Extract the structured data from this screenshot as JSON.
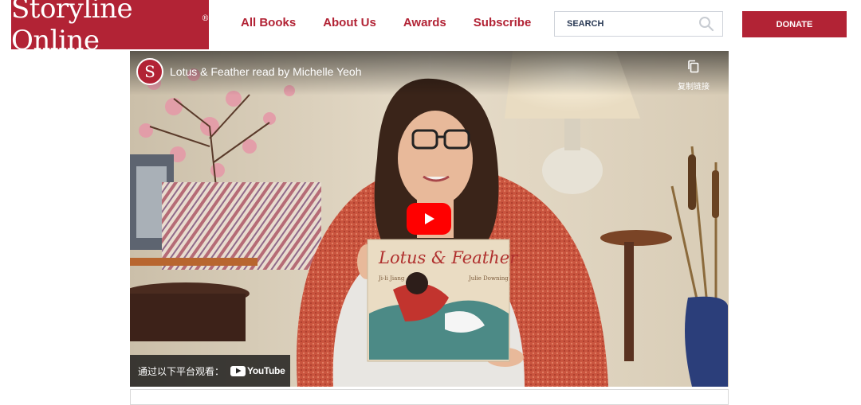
{
  "header": {
    "logo_text": "Storyline Online",
    "logo_mark": "®",
    "nav": [
      {
        "label": "All Books"
      },
      {
        "label": "About Us"
      },
      {
        "label": "Awards"
      },
      {
        "label": "Subscribe"
      }
    ],
    "search": {
      "placeholder": "SEARCH",
      "icon": "search-icon"
    },
    "donate_label": "DONATE"
  },
  "video": {
    "channel_initial": "S",
    "title": "Lotus & Feather read by Michelle Yeoh",
    "copy_link_label": "复制链接",
    "watch_on_label": "通过以下平台观看：",
    "youtube_label": "YouTube",
    "book_title": "Lotus & Feather",
    "book_author": "Ji-li Jiang",
    "book_illustrator": "Julie Downing"
  },
  "colors": {
    "brand": "#b22335",
    "youtube_red": "#ff0000"
  }
}
